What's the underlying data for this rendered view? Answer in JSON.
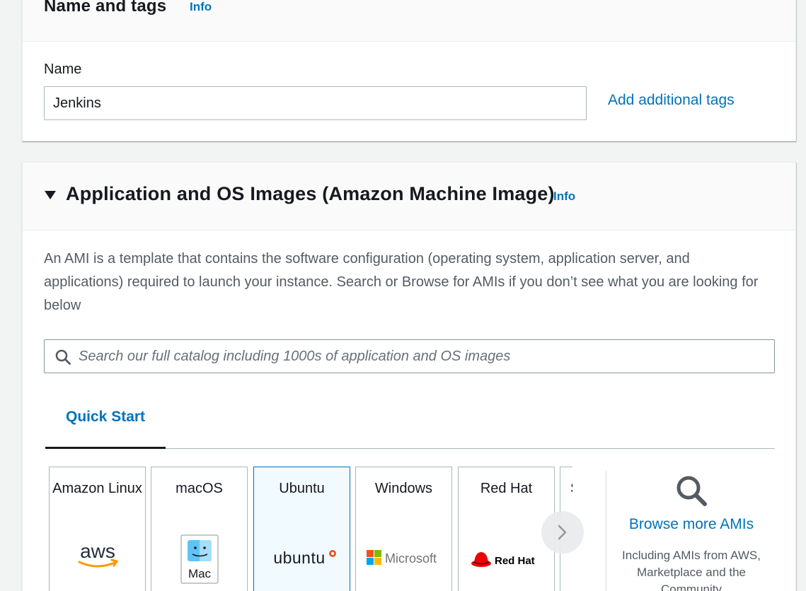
{
  "name_and_tags": {
    "title": "Name and tags",
    "info": "Info",
    "name_label": "Name",
    "name_value": "Jenkins",
    "add_tags_label": "Add additional tags"
  },
  "ami": {
    "title": "Application and OS Images (Amazon Machine Image)",
    "info": "Info",
    "description": "An AMI is a template that contains the software configuration (operating system, application server, and applications) required to launch your instance. Search or Browse for AMIs if you don’t see what you are looking for below",
    "search_placeholder": "Search our full catalog including 1000s of application and OS images",
    "tab_label": "Quick Start",
    "os_options": [
      {
        "name": "Amazon Linux",
        "logo": "aws"
      },
      {
        "name": "macOS",
        "logo": "Mac"
      },
      {
        "name": "Ubuntu",
        "logo": "ubuntu",
        "selected": true
      },
      {
        "name": "Windows",
        "logo": "Microsoft"
      },
      {
        "name": "Red Hat",
        "logo": "Red Hat"
      },
      {
        "name": "S",
        "logo": ""
      }
    ],
    "browse": {
      "link": "Browse more AMIs",
      "subtitle": "Including AMIs from AWS, Marketplace and the Community"
    }
  },
  "colors": {
    "link": "#0073bb",
    "selected_bg": "#f1faff",
    "ubuntu": "#e95420",
    "redhat": "#ee0000",
    "aws_orange": "#ff9900"
  }
}
